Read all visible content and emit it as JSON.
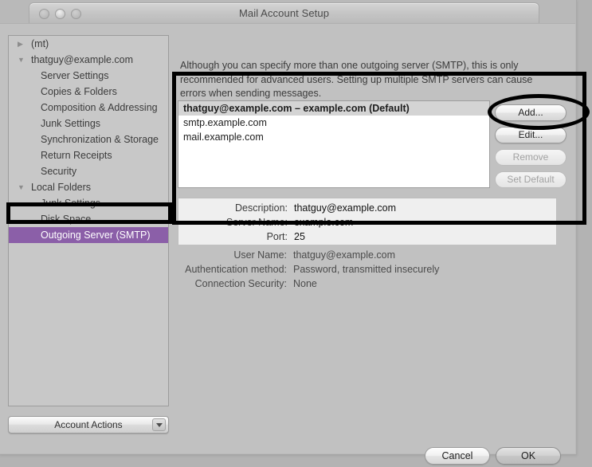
{
  "window": {
    "title": "Mail Account Setup",
    "traffic_lights": [
      "close",
      "minimize",
      "zoom"
    ]
  },
  "sidebar": {
    "items": [
      {
        "label": "(mt)",
        "level": "root",
        "disclosure": "▶",
        "selected": false
      },
      {
        "label": "thatguy@example.com",
        "level": "root",
        "disclosure": "▼",
        "selected": false
      },
      {
        "label": "Server Settings",
        "level": "child",
        "disclosure": "",
        "selected": false
      },
      {
        "label": "Copies & Folders",
        "level": "child",
        "disclosure": "",
        "selected": false
      },
      {
        "label": "Composition & Addressing",
        "level": "child",
        "disclosure": "",
        "selected": false
      },
      {
        "label": "Junk Settings",
        "level": "child",
        "disclosure": "",
        "selected": false
      },
      {
        "label": "Synchronization & Storage",
        "level": "child",
        "disclosure": "",
        "selected": false
      },
      {
        "label": "Return Receipts",
        "level": "child",
        "disclosure": "",
        "selected": false
      },
      {
        "label": "Security",
        "level": "child",
        "disclosure": "",
        "selected": false
      },
      {
        "label": "Local Folders",
        "level": "root",
        "disclosure": "▼",
        "selected": false
      },
      {
        "label": "Junk Settings",
        "level": "child",
        "disclosure": "",
        "selected": false
      },
      {
        "label": "Disk Space",
        "level": "child",
        "disclosure": "",
        "selected": false
      },
      {
        "label": "Outgoing Server (SMTP)",
        "level": "child",
        "disclosure": "",
        "selected": true
      }
    ],
    "account_actions_label": "Account Actions",
    "selected_color": "#8b5fa8"
  },
  "main": {
    "intro_text": "Although you can specify more than one outgoing server (SMTP), this is only recommended for advanced users. Setting up multiple SMTP servers can cause errors when sending messages.",
    "server_list": [
      {
        "label": "thatguy@example.com – example.com (Default)",
        "selected": true
      },
      {
        "label": "smtp.example.com",
        "selected": false
      },
      {
        "label": "mail.example.com",
        "selected": false
      }
    ],
    "buttons": [
      {
        "label": "Add...",
        "enabled": true
      },
      {
        "label": "Edit...",
        "enabled": true
      },
      {
        "label": "Remove",
        "enabled": false
      },
      {
        "label": "Set Default",
        "enabled": false
      }
    ],
    "details": [
      {
        "label": "Description:",
        "value": "thatguy@example.com"
      },
      {
        "label": "Server Name:",
        "value": "example.com"
      },
      {
        "label": "Port:",
        "value": "25"
      },
      {
        "label": "User Name:",
        "value": "thatguy@example.com"
      },
      {
        "label": "Authentication method:",
        "value": "Password, transmitted insecurely"
      },
      {
        "label": "Connection Security:",
        "value": "None"
      }
    ]
  },
  "footer": {
    "cancel_label": "Cancel",
    "ok_label": "OK"
  }
}
